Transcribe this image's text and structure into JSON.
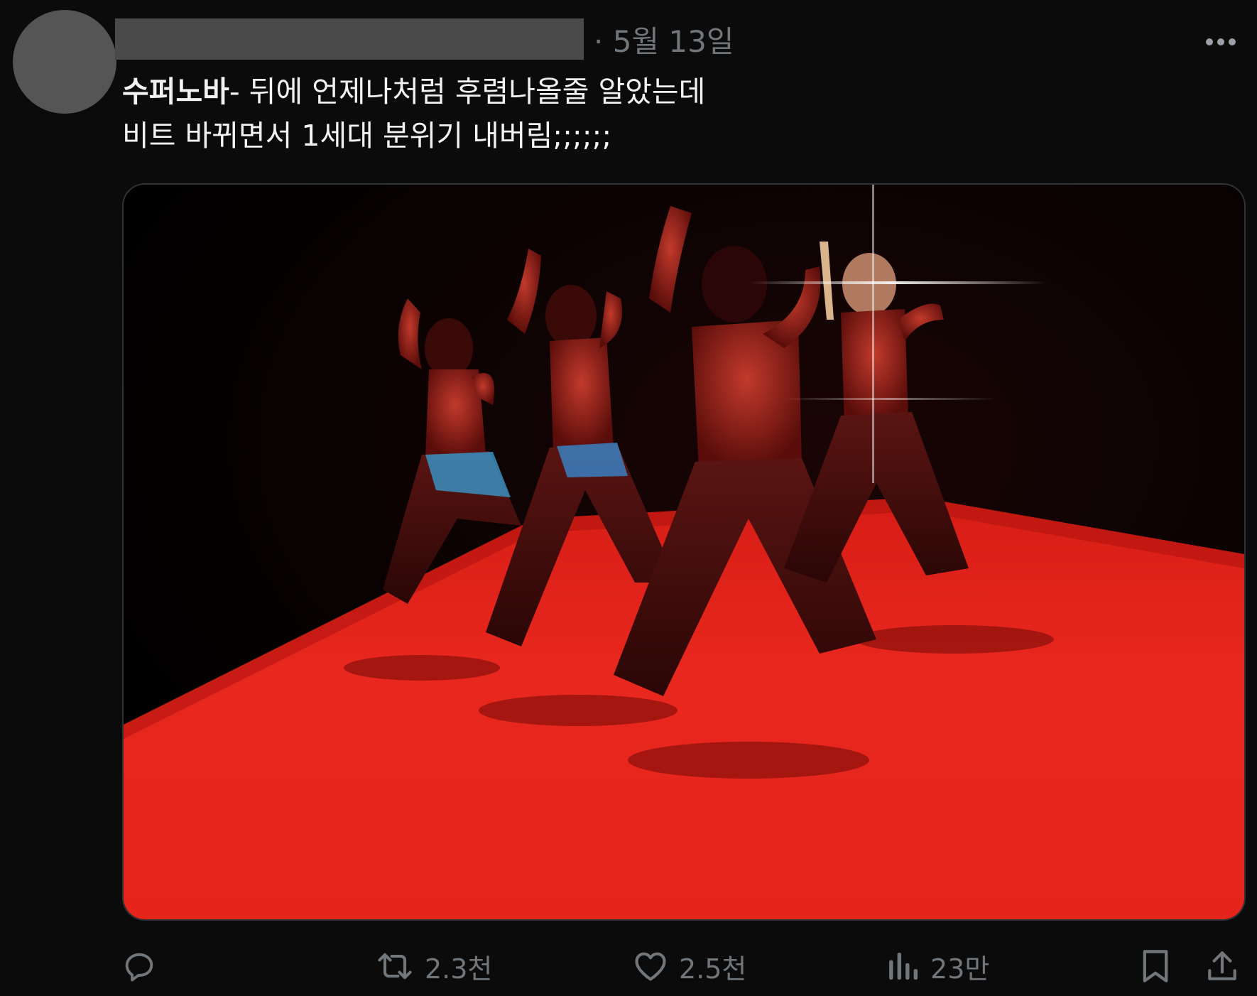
{
  "post": {
    "timestamp": "· 5월 13일",
    "text_bold": "수퍼노바",
    "text_line1_rest": "- 뒤에 언제나처럼 후렴나올줄 알았는데",
    "text_line2": "비트 바뀌면서 1세대 분위기 내버림;;;;;;"
  },
  "actions": {
    "reply_count": "",
    "retweet_count": "2.3천",
    "like_count": "2.5천",
    "views_count": "23만"
  },
  "icons": {
    "more": "more-horizontal-icon",
    "reply": "reply-icon",
    "retweet": "retweet-icon",
    "like": "heart-icon",
    "views": "analytics-icon",
    "bookmark": "bookmark-icon",
    "share": "share-icon"
  },
  "colors": {
    "background": "#0b0b0b",
    "text": "#e7e9ea",
    "muted": "#71767b",
    "stage_red": "#e8271e"
  }
}
